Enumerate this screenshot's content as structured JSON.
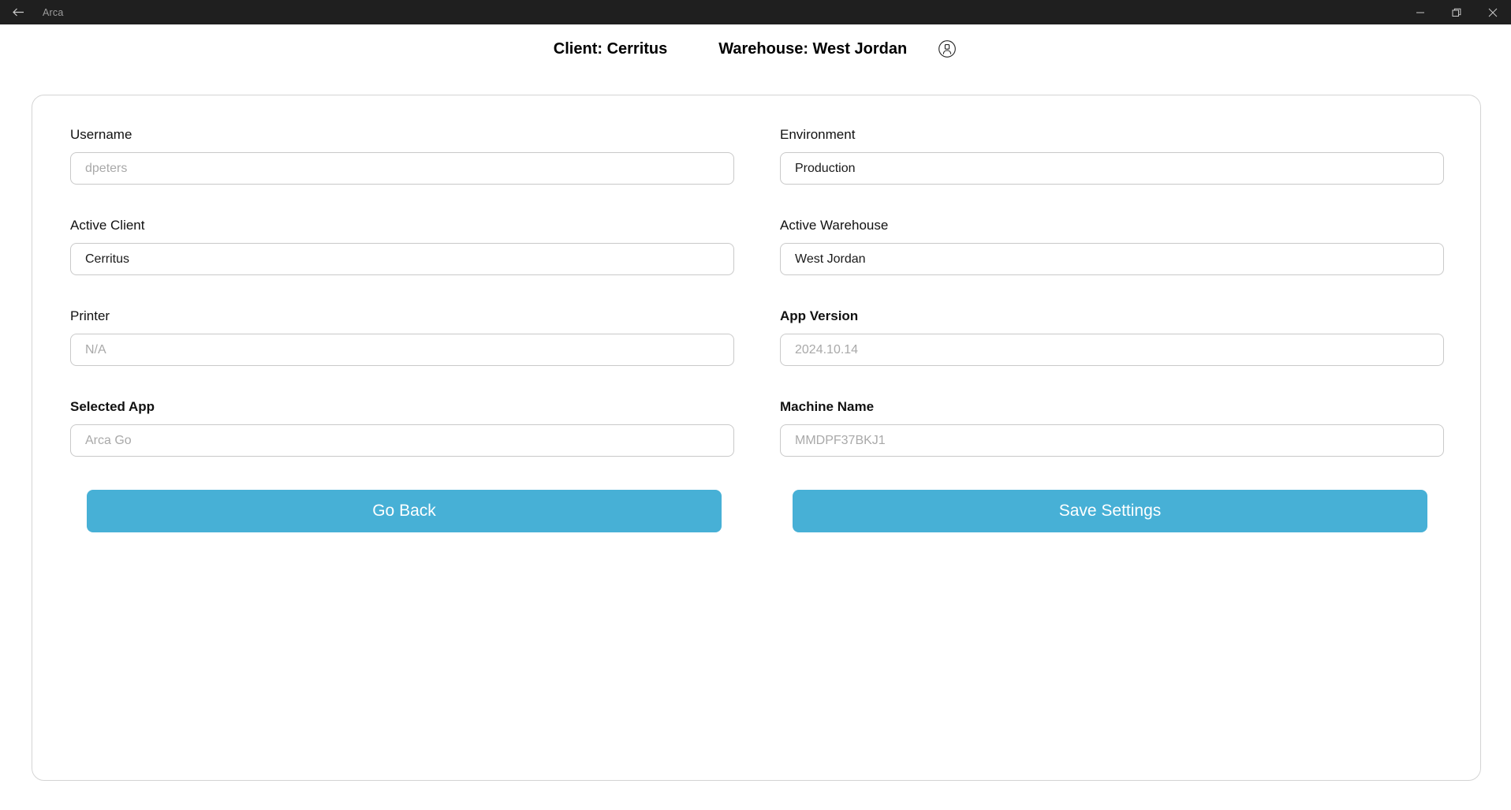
{
  "titlebar": {
    "back_icon": "arrow-left-icon",
    "app_name": "Arca",
    "minimize_label": "Minimize",
    "maximize_label": "Restore",
    "close_label": "Close"
  },
  "header": {
    "client": "Client: Cerritus",
    "warehouse": "Warehouse: West Jordan",
    "account_icon": "user-circle-icon"
  },
  "form": {
    "rows": [
      {
        "left": {
          "label": "Username",
          "bold": false,
          "value": "dpeters",
          "is_placeholder": true
        },
        "right": {
          "label": "Environment",
          "bold": false,
          "value": "Production",
          "is_placeholder": false
        }
      },
      {
        "left": {
          "label": "Active Client",
          "bold": false,
          "value": "Cerritus",
          "is_placeholder": false
        },
        "right": {
          "label": "Active Warehouse",
          "bold": false,
          "value": "West Jordan",
          "is_placeholder": false
        }
      },
      {
        "left": {
          "label": "Printer",
          "bold": false,
          "value": "N/A",
          "is_placeholder": true
        },
        "right": {
          "label": "App Version",
          "bold": true,
          "value": "2024.10.14",
          "is_placeholder": true
        }
      },
      {
        "left": {
          "label": "Selected App",
          "bold": true,
          "value": "Arca Go",
          "is_placeholder": true
        },
        "right": {
          "label": "Machine Name",
          "bold": true,
          "value": "MMDPF37BKJ1",
          "is_placeholder": true
        }
      }
    ]
  },
  "actions": {
    "go_back_label": "Go Back",
    "save_settings_label": "Save Settings"
  },
  "colors": {
    "accent": "#47b0d6",
    "titlebar": "#1f1f1f",
    "border": "#c9c9c9",
    "card_border": "#d4d4d4",
    "placeholder_text": "#a9a9a9"
  }
}
